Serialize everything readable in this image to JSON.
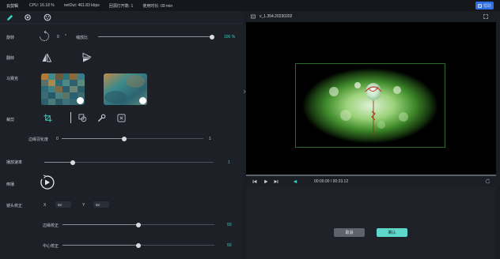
{
  "topbar": {
    "app_name": "云剪辑",
    "cpu": "CPU: 16.18 %",
    "netout": "netOut: 461.83 kbps",
    "rtc": "回源打开数: 1",
    "elapsed": "使用时长: 09 min",
    "help_label": "帮助"
  },
  "left": {
    "rotate": {
      "label": "旋转",
      "value": "0",
      "unit": "°"
    },
    "scale": {
      "label": "缩放比",
      "value": "100 %",
      "level": 1.0
    },
    "flip": {
      "label": "翻转"
    },
    "mosaic": {
      "label": "马赛克"
    },
    "crop": {
      "label": "裁剪"
    },
    "edge_blur": {
      "label": "边缘羽化度",
      "min": "0",
      "max": "1",
      "level": 0.44
    },
    "playback_rate": {
      "label": "播放速率",
      "value": "1",
      "level": 0.17
    },
    "reverse": {
      "label": "倒播"
    },
    "lens_correct": {
      "label": "镜头校正",
      "x_label": "X",
      "x_value": "50",
      "y_label": "Y",
      "y_value": "50"
    },
    "edge_correct": {
      "label": "边缘校正",
      "value": "50",
      "level": 0.5
    },
    "center_correct": {
      "label": "中心校正",
      "value": "50",
      "level": 0.5
    }
  },
  "preview": {
    "file_name": "v_1.354.20230202",
    "time": "00:00.00 / 00:23.12",
    "cancel_label": "取消",
    "ok_label": "确认"
  },
  "colors": {
    "accent_teal": "#3bd3c3",
    "help_blue": "#2d6fe8",
    "crop_frame": "#2b6a2b"
  }
}
